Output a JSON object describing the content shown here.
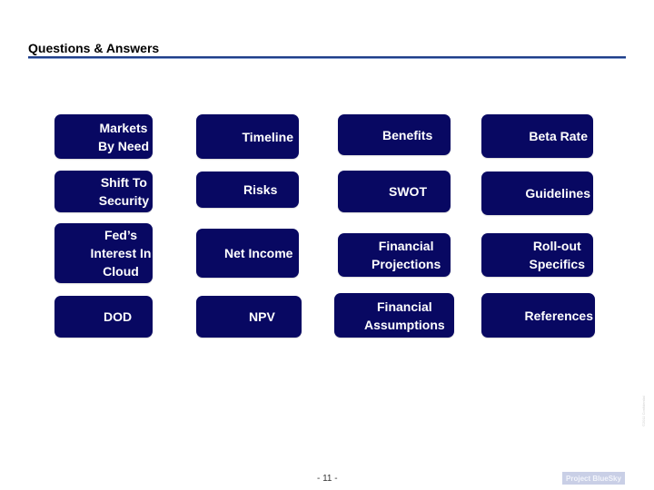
{
  "header": {
    "title": "Questions & Answers",
    "accent_color": "#1f3f8a"
  },
  "buttons": {
    "markets_by_need": "Markets\nBy Need",
    "shift_to_security": "Shift To\nSecurity",
    "feds_interest_in_cloud": "Fed’s\nInterest In\nCloud",
    "dod": "DOD",
    "timeline": "Timeline",
    "risks": "Risks",
    "net_income": "Net Income",
    "npv": "NPV",
    "benefits": "Benefits",
    "swot": "SWOT",
    "financial_projections": "Financial\nProjections",
    "financial_assumptions": "Financial\nAssumptions",
    "beta_rate": "Beta Rate",
    "guidelines": "Guidelines",
    "rollout_specifics": "Roll-out\nSpecifics",
    "references": "References",
    "button_color": "#080862"
  },
  "footer": {
    "page_number": "- 11 -",
    "project_badge": "Project BlueSky",
    "side_note": "©2011 Confidential"
  }
}
